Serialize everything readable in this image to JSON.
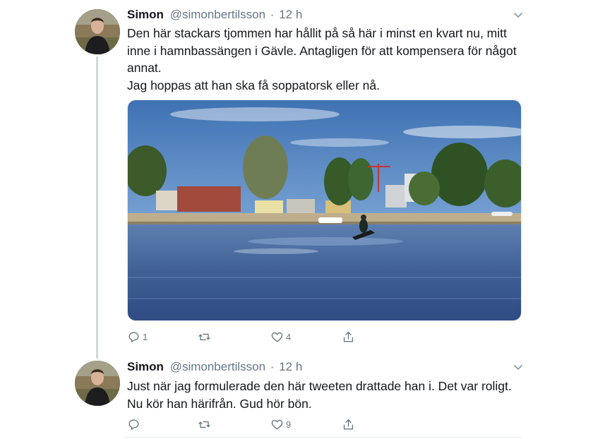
{
  "tweets": [
    {
      "name": "Simon",
      "handle": "@simonbertilsson",
      "separator": "·",
      "time": "12 h",
      "lines": [
        "Den här stackars tjommen har hållit på så här i minst en kvart nu, mitt",
        "inne i hamnbassängen i Gävle. Antagligen för att kompensera för något",
        "annat.",
        "Jag hoppas att han ska få soppatorsk eller nå."
      ],
      "reply_count": "1",
      "retweet_count": "",
      "like_count": "4",
      "icons": [
        "reply-icon",
        "retweet-icon",
        "like-icon",
        "share-icon"
      ]
    },
    {
      "name": "Simon",
      "handle": "@simonbertilsson",
      "separator": "·",
      "time": "12 h",
      "lines": [
        "Just när jag formulerade den här tweeten drattade han i. Det var roligt.",
        "Nu kör han härifrån. Gud hör bön."
      ],
      "reply_count": "",
      "retweet_count": "",
      "like_count": "9",
      "icons": [
        "reply-icon",
        "retweet-icon",
        "like-icon",
        "share-icon"
      ]
    }
  ],
  "colors": {
    "text": "#14171a",
    "secondary": "#657786",
    "thread_line": "#cfd9de"
  }
}
